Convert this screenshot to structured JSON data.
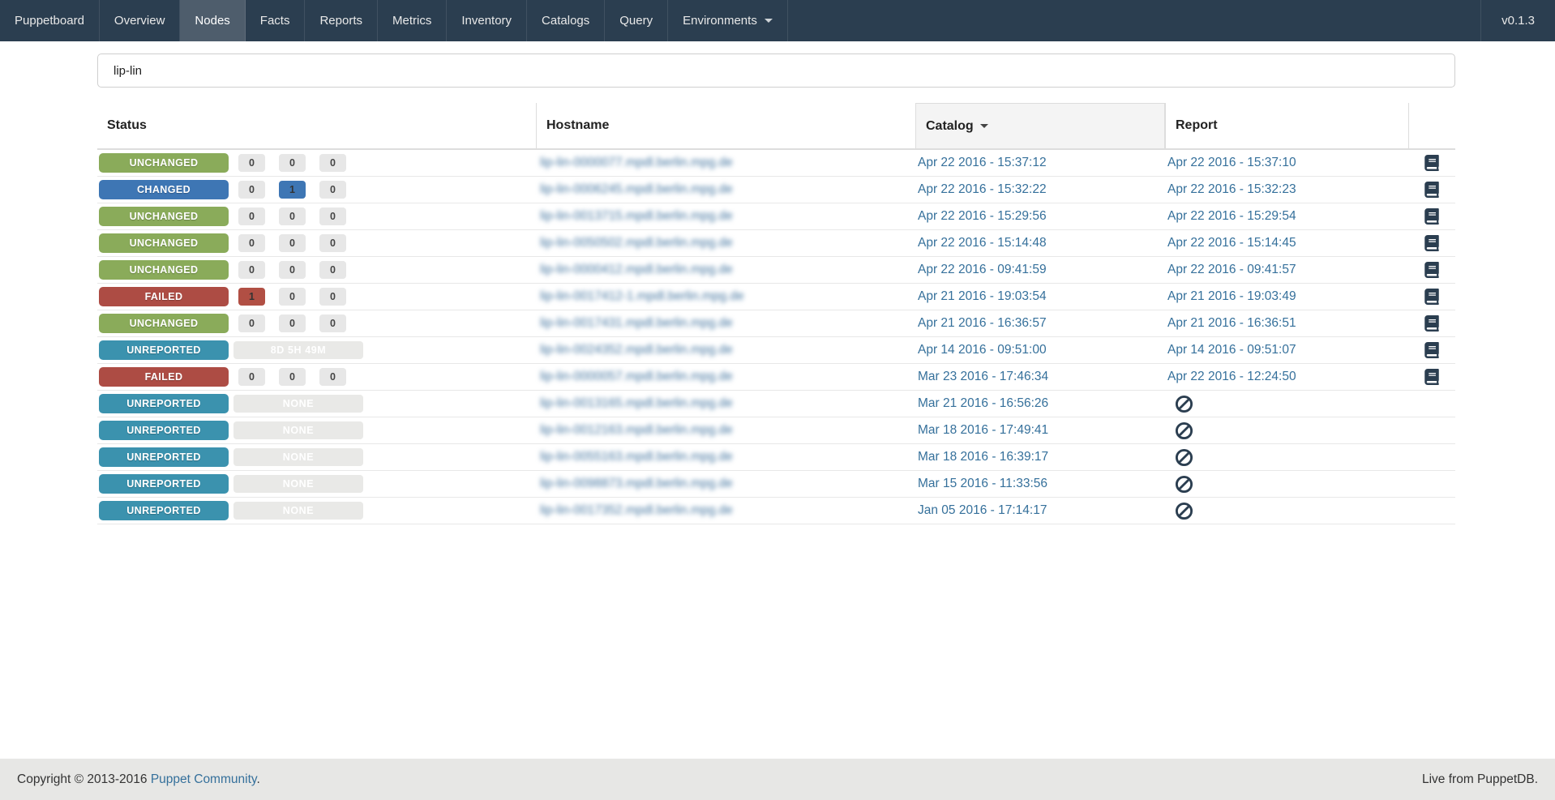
{
  "navbar": {
    "brand": "Puppetboard",
    "items": [
      {
        "label": "Overview",
        "active": false
      },
      {
        "label": "Nodes",
        "active": true
      },
      {
        "label": "Facts",
        "active": false
      },
      {
        "label": "Reports",
        "active": false
      },
      {
        "label": "Metrics",
        "active": false
      },
      {
        "label": "Inventory",
        "active": false
      },
      {
        "label": "Catalogs",
        "active": false
      },
      {
        "label": "Query",
        "active": false
      }
    ],
    "environments_label": "Environments",
    "version": "v0.1.3"
  },
  "search": {
    "value": "lip-lin",
    "placeholder": ""
  },
  "table": {
    "columns": {
      "status": "Status",
      "hostname": "Hostname",
      "catalog": "Catalog",
      "report": "Report"
    },
    "sorted_column": "Catalog",
    "sort_direction": "desc",
    "status_colors": {
      "unchanged": "#8aab5a",
      "changed": "#3e76b4",
      "failed": "#ad4c44",
      "unreported": "#3b92ae"
    },
    "count_colors": {
      "failed": "#b14f44",
      "changed": "#3e76b4"
    },
    "rows": [
      {
        "status": "UNCHANGED",
        "status_type": "unchanged",
        "counts": [
          {
            "value": "0",
            "variant": "default"
          },
          {
            "value": "0",
            "variant": "default"
          },
          {
            "value": "0",
            "variant": "default"
          }
        ],
        "wide_badge": null,
        "hostname_redacted": "lip-lin-0000077.mpdl.berlin.mpg.de",
        "catalog": "Apr 22 2016 - 15:37:12",
        "report": "Apr 22 2016 - 15:37:10",
        "report_icon": "book"
      },
      {
        "status": "CHANGED",
        "status_type": "changed",
        "counts": [
          {
            "value": "0",
            "variant": "default"
          },
          {
            "value": "1",
            "variant": "changed"
          },
          {
            "value": "0",
            "variant": "default"
          }
        ],
        "wide_badge": null,
        "hostname_redacted": "lip-lin-0006245.mpdl.berlin.mpg.de",
        "catalog": "Apr 22 2016 - 15:32:22",
        "report": "Apr 22 2016 - 15:32:23",
        "report_icon": "book"
      },
      {
        "status": "UNCHANGED",
        "status_type": "unchanged",
        "counts": [
          {
            "value": "0",
            "variant": "default"
          },
          {
            "value": "0",
            "variant": "default"
          },
          {
            "value": "0",
            "variant": "default"
          }
        ],
        "wide_badge": null,
        "hostname_redacted": "lip-lin-0013715.mpdl.berlin.mpg.de",
        "catalog": "Apr 22 2016 - 15:29:56",
        "report": "Apr 22 2016 - 15:29:54",
        "report_icon": "book"
      },
      {
        "status": "UNCHANGED",
        "status_type": "unchanged",
        "counts": [
          {
            "value": "0",
            "variant": "default"
          },
          {
            "value": "0",
            "variant": "default"
          },
          {
            "value": "0",
            "variant": "default"
          }
        ],
        "wide_badge": null,
        "hostname_redacted": "lip-lin-0050502.mpdl.berlin.mpg.de",
        "catalog": "Apr 22 2016 - 15:14:48",
        "report": "Apr 22 2016 - 15:14:45",
        "report_icon": "book"
      },
      {
        "status": "UNCHANGED",
        "status_type": "unchanged",
        "counts": [
          {
            "value": "0",
            "variant": "default"
          },
          {
            "value": "0",
            "variant": "default"
          },
          {
            "value": "0",
            "variant": "default"
          }
        ],
        "wide_badge": null,
        "hostname_redacted": "lip-lin-0000412.mpdl.berlin.mpg.de",
        "catalog": "Apr 22 2016 - 09:41:59",
        "report": "Apr 22 2016 - 09:41:57",
        "report_icon": "book"
      },
      {
        "status": "FAILED",
        "status_type": "failed",
        "counts": [
          {
            "value": "1",
            "variant": "failed"
          },
          {
            "value": "0",
            "variant": "default"
          },
          {
            "value": "0",
            "variant": "default"
          }
        ],
        "wide_badge": null,
        "hostname_redacted": "lip-lin-0017412-1.mpdl.berlin.mpg.de",
        "catalog": "Apr 21 2016 - 19:03:54",
        "report": "Apr 21 2016 - 19:03:49",
        "report_icon": "book"
      },
      {
        "status": "UNCHANGED",
        "status_type": "unchanged",
        "counts": [
          {
            "value": "0",
            "variant": "default"
          },
          {
            "value": "0",
            "variant": "default"
          },
          {
            "value": "0",
            "variant": "default"
          }
        ],
        "wide_badge": null,
        "hostname_redacted": "lip-lin-0017431.mpdl.berlin.mpg.de",
        "catalog": "Apr 21 2016 - 16:36:57",
        "report": "Apr 21 2016 - 16:36:51",
        "report_icon": "book"
      },
      {
        "status": "UNREPORTED",
        "status_type": "unreported",
        "counts": [],
        "wide_badge": "8D 5H 49M",
        "hostname_redacted": "lip-lin-0024352.mpdl.berlin.mpg.de",
        "catalog": "Apr 14 2016 - 09:51:00",
        "report": "Apr 14 2016 - 09:51:07",
        "report_icon": "book"
      },
      {
        "status": "FAILED",
        "status_type": "failed",
        "counts": [
          {
            "value": "0",
            "variant": "default"
          },
          {
            "value": "0",
            "variant": "default"
          },
          {
            "value": "0",
            "variant": "default"
          }
        ],
        "wide_badge": null,
        "hostname_redacted": "lip-lin-0000057.mpdl.berlin.mpg.de",
        "catalog": "Mar 23 2016 - 17:46:34",
        "report": "Apr 22 2016 - 12:24:50",
        "report_icon": "book"
      },
      {
        "status": "UNREPORTED",
        "status_type": "unreported",
        "counts": [],
        "wide_badge": "NONE",
        "hostname_redacted": "lip-lin-0013165.mpdl.berlin.mpg.de",
        "catalog": "Mar 21 2016 - 16:56:26",
        "report": null,
        "report_icon": "ban"
      },
      {
        "status": "UNREPORTED",
        "status_type": "unreported",
        "counts": [],
        "wide_badge": "NONE",
        "hostname_redacted": "lip-lin-0012163.mpdl.berlin.mpg.de",
        "catalog": "Mar 18 2016 - 17:49:41",
        "report": null,
        "report_icon": "ban"
      },
      {
        "status": "UNREPORTED",
        "status_type": "unreported",
        "counts": [],
        "wide_badge": "NONE",
        "hostname_redacted": "lip-lin-0055163.mpdl.berlin.mpg.de",
        "catalog": "Mar 18 2016 - 16:39:17",
        "report": null,
        "report_icon": "ban"
      },
      {
        "status": "UNREPORTED",
        "status_type": "unreported",
        "counts": [],
        "wide_badge": "NONE",
        "hostname_redacted": "lip-lin-0098873.mpdl.berlin.mpg.de",
        "catalog": "Mar 15 2016 - 11:33:56",
        "report": null,
        "report_icon": "ban"
      },
      {
        "status": "UNREPORTED",
        "status_type": "unreported",
        "counts": [],
        "wide_badge": "NONE",
        "hostname_redacted": "lip-lin-0017352.mpdl.berlin.mpg.de",
        "catalog": "Jan 05 2016 - 17:14:17",
        "report": null,
        "report_icon": "ban"
      }
    ]
  },
  "footer": {
    "copyright_prefix": "Copyright © 2013-2016 ",
    "community_link": "Puppet Community",
    "copyright_suffix": ".",
    "right_text": "Live from PuppetDB."
  },
  "colors": {
    "navbar_bg": "#2b3e50",
    "navbar_active_bg": "#4e5d6c",
    "link_blue": "#35709b",
    "footer_bg": "#e7e7e5",
    "icon_dark": "#2b3e50"
  }
}
